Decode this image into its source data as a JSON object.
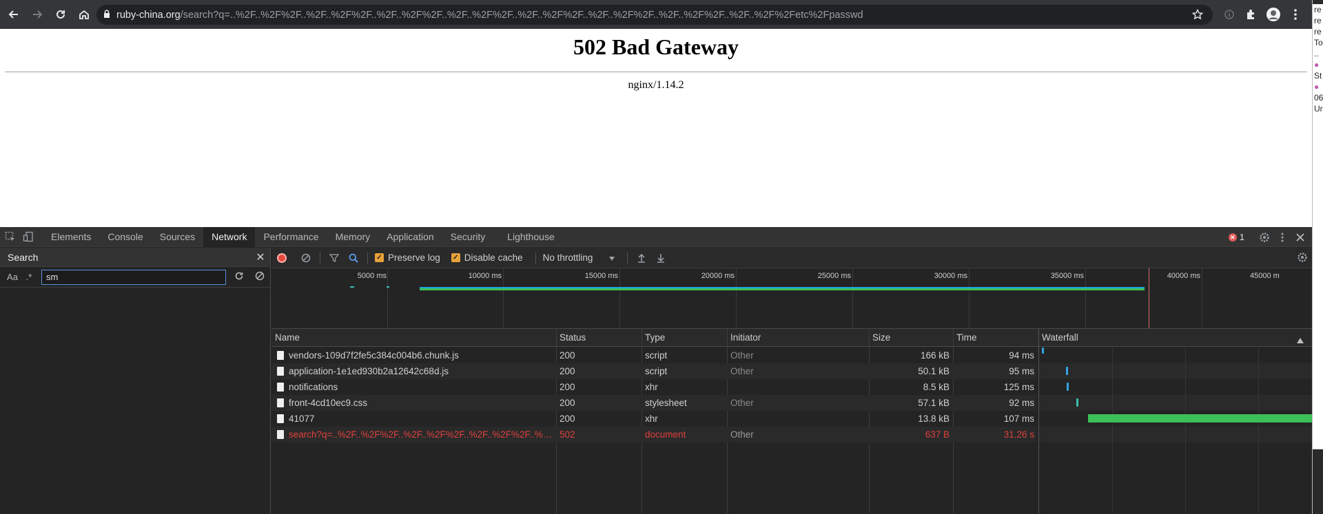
{
  "browser": {
    "url_host": "ruby-china.org",
    "url_path": "/search?q=..%2F..%2F%2F..%2F..%2F%2F..%2F..%2F%2F..%2F..%2F%2F..%2F..%2F%2F..%2F..%2F%2F..%2F..%2F%2F..%2F..%2F%2Fetc%2Fpasswd"
  },
  "page": {
    "heading": "502 Bad Gateway",
    "server": "nginx/1.14.2"
  },
  "devtools": {
    "tabs": [
      "Elements",
      "Console",
      "Sources",
      "Network",
      "Performance",
      "Memory",
      "Application",
      "Security",
      "Lighthouse"
    ],
    "active_tab": "Network",
    "error_count": "1"
  },
  "search": {
    "title": "Search",
    "case_label": "Aa",
    "regex_label": ".*",
    "query": "sm"
  },
  "network_toolbar": {
    "preserve_log": "Preserve log",
    "disable_cache": "Disable cache",
    "throttling": "No throttling"
  },
  "overview": {
    "ticks": [
      "5000 ms",
      "10000 ms",
      "15000 ms",
      "20000 ms",
      "25000 ms",
      "30000 ms",
      "35000 ms",
      "40000 ms",
      "45000 m"
    ]
  },
  "table": {
    "columns": [
      "Name",
      "Status",
      "Type",
      "Initiator",
      "Size",
      "Time",
      "Waterfall"
    ],
    "rows": [
      {
        "name": "vendors-109d7f2fe5c384c004b6.chunk.js",
        "status": "200",
        "type": "script",
        "initiator": "Other",
        "size": "166 kB",
        "time": "94 ms"
      },
      {
        "name": "application-1e1ed930b2a12642c68d.js",
        "status": "200",
        "type": "script",
        "initiator": "Other",
        "size": "50.1 kB",
        "time": "95 ms"
      },
      {
        "name": "notifications",
        "status": "200",
        "type": "xhr",
        "initiator": "",
        "size": "8.5 kB",
        "time": "125 ms"
      },
      {
        "name": "front-4cd10ec9.css",
        "status": "200",
        "type": "stylesheet",
        "initiator": "Other",
        "size": "57.1 kB",
        "time": "92 ms"
      },
      {
        "name": "41077",
        "status": "200",
        "type": "xhr",
        "initiator": "",
        "size": "13.8 kB",
        "time": "107 ms"
      },
      {
        "name": "search?q=..%2F..%2F%2F..%2F..%2F%2F..%2F..%2F%2F..%2F..%2F%2F..",
        "status": "502",
        "type": "document",
        "initiator": "Other",
        "size": "637 B",
        "time": "31.26 s"
      }
    ]
  },
  "side_window": {
    "lines": [
      "re",
      "re",
      "re",
      "To",
      "..",
      "",
      "St",
      "",
      "06",
      "Ur"
    ]
  },
  "colors": {
    "error_red": "#e0403c",
    "waterfall_green": "#3cc057",
    "waterfall_blue": "#35a4e6",
    "checkbox_orange": "#e8a23a"
  }
}
